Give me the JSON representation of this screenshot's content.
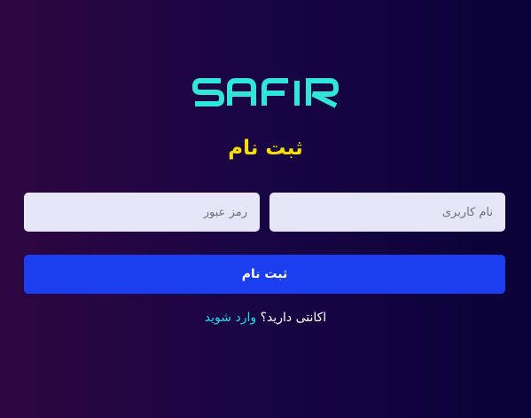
{
  "logo": {
    "text": "SAFIR",
    "color": "#2fe6d8"
  },
  "form": {
    "title": "ثبت نام",
    "username_placeholder": "نام کاربری",
    "password_placeholder": "رمز عبور",
    "submit_label": "ثبت نام"
  },
  "footer": {
    "prompt": "اکانتی دارید؟",
    "link_label": "وارد شوید"
  },
  "colors": {
    "title": "#f5e000",
    "button": "#1b3ff0",
    "link": "#26d9e3",
    "field_bg": "#e6e5f8"
  }
}
